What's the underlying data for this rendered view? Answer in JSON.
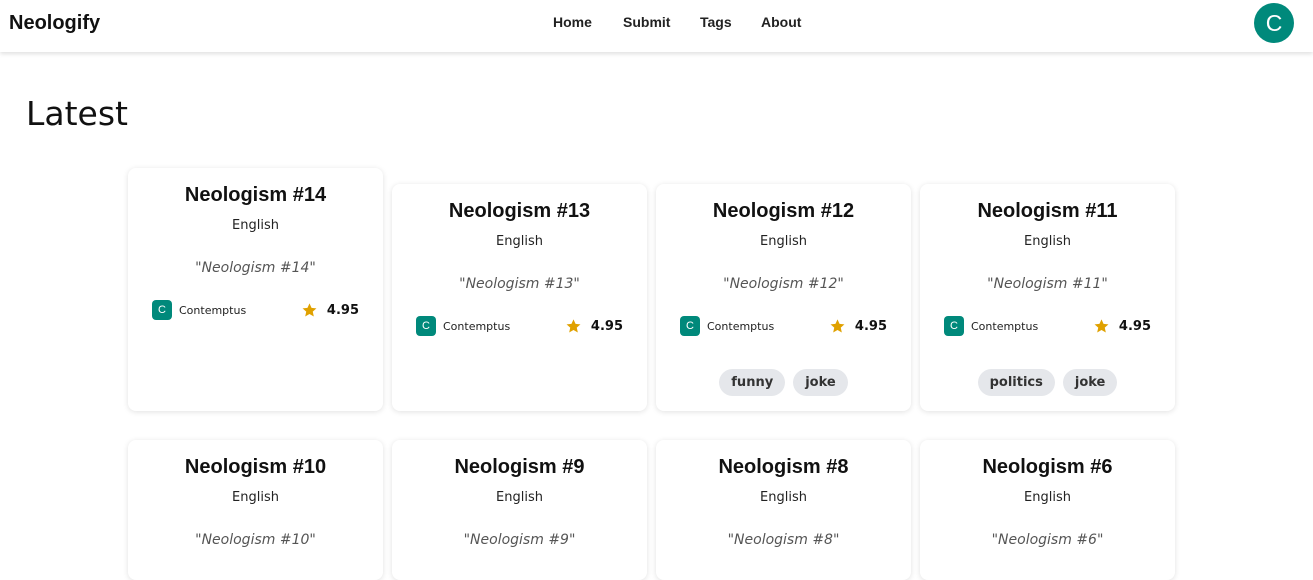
{
  "app": {
    "brand": "Neologify"
  },
  "nav": {
    "items": [
      "Home",
      "Submit",
      "Tags",
      "About"
    ]
  },
  "user": {
    "avatar_initial": "C",
    "avatar_color": "#00897b"
  },
  "page": {
    "title": "Latest"
  },
  "colors": {
    "accent": "#00897b",
    "star": "#e0a100",
    "tag_bg": "#e5e7eb"
  },
  "cards": [
    {
      "title": "Neologism #14",
      "language": "English",
      "definition": "\"Neologism #14\"",
      "author_initial": "C",
      "author": "Contemptus",
      "rating": "4.95",
      "tags": []
    },
    {
      "title": "Neologism #13",
      "language": "English",
      "definition": "\"Neologism #13\"",
      "author_initial": "C",
      "author": "Contemptus",
      "rating": "4.95",
      "tags": []
    },
    {
      "title": "Neologism #12",
      "language": "English",
      "definition": "\"Neologism #12\"",
      "author_initial": "C",
      "author": "Contemptus",
      "rating": "4.95",
      "tags": [
        "funny",
        "joke"
      ]
    },
    {
      "title": "Neologism #11",
      "language": "English",
      "definition": "\"Neologism #11\"",
      "author_initial": "C",
      "author": "Contemptus",
      "rating": "4.95",
      "tags": [
        "politics",
        "joke"
      ]
    },
    {
      "title": "Neologism #10",
      "language": "English",
      "definition": "\"Neologism #10\""
    },
    {
      "title": "Neologism #9",
      "language": "English",
      "definition": "\"Neologism #9\""
    },
    {
      "title": "Neologism #8",
      "language": "English",
      "definition": "\"Neologism #8\""
    },
    {
      "title": "Neologism #6",
      "language": "English",
      "definition": "\"Neologism #6\""
    }
  ]
}
